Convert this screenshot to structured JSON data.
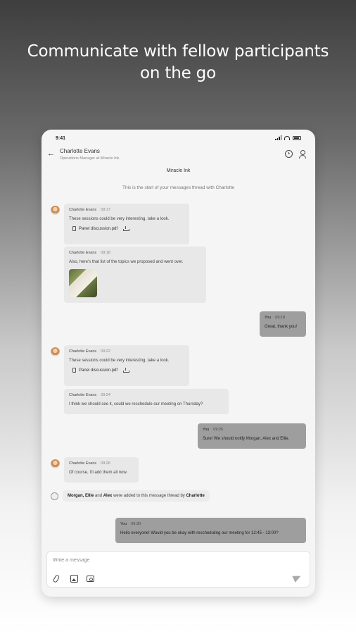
{
  "headline": {
    "line1": "Communicate with fellow participants",
    "line2": "on the go"
  },
  "status_bar": {
    "time": "9:41"
  },
  "header": {
    "contact_name": "Charlotte Evans",
    "contact_role": "Operations Manager at Miracle Ink"
  },
  "thread": {
    "title": "Miracle Ink",
    "start_text": "This is the start of your messages thread with Charlotte"
  },
  "messages": [
    {
      "sender": "Charlotte Evans",
      "time": "09:17",
      "text": "These sessions could be very interesting, take a look.",
      "file": "Panel discussion.pdf"
    },
    {
      "sender": "Charlotte Evans",
      "time": "09:18",
      "text": "Also, here's that list of the topics we proposed and went over."
    },
    {
      "sender": "You",
      "time": "09:18",
      "text": "Great, thank you!"
    },
    {
      "sender": "Charlotte Evans",
      "time": "09:22",
      "text": "These sessions could be very interesting, take a look.",
      "file": "Panel discussion.pdf"
    },
    {
      "sender": "Charlotte Evans",
      "time": "09:24",
      "text": "I think we should see it, could we reschedule our meeting on Thursday?"
    },
    {
      "sender": "You",
      "time": "09:25",
      "text": "Sure! We should notify Morgan, Alex and Ellie."
    },
    {
      "sender": "Charlotte Evans",
      "time": "09:26",
      "text": "Of course, I'll add them all now."
    },
    {
      "sender": "You",
      "time": "09:30",
      "text": "Hello everyone! Would you be okay with rescheduling our meeting for 12:45 - 13:00?"
    }
  ],
  "system_message": {
    "names": "Morgan, Ellie",
    "and_word": "and",
    "name_last": "Alex",
    "middle": "were added to this message thread by",
    "actor": "Charlotte"
  },
  "composer": {
    "placeholder": "Write a message"
  },
  "icons": {
    "back": "arrow-left-icon",
    "history": "clock-icon",
    "profile": "person-icon",
    "attach": "paperclip-icon",
    "image": "image-icon",
    "camera": "camera-icon",
    "send": "send-icon",
    "file": "document-icon",
    "download": "download-icon"
  }
}
